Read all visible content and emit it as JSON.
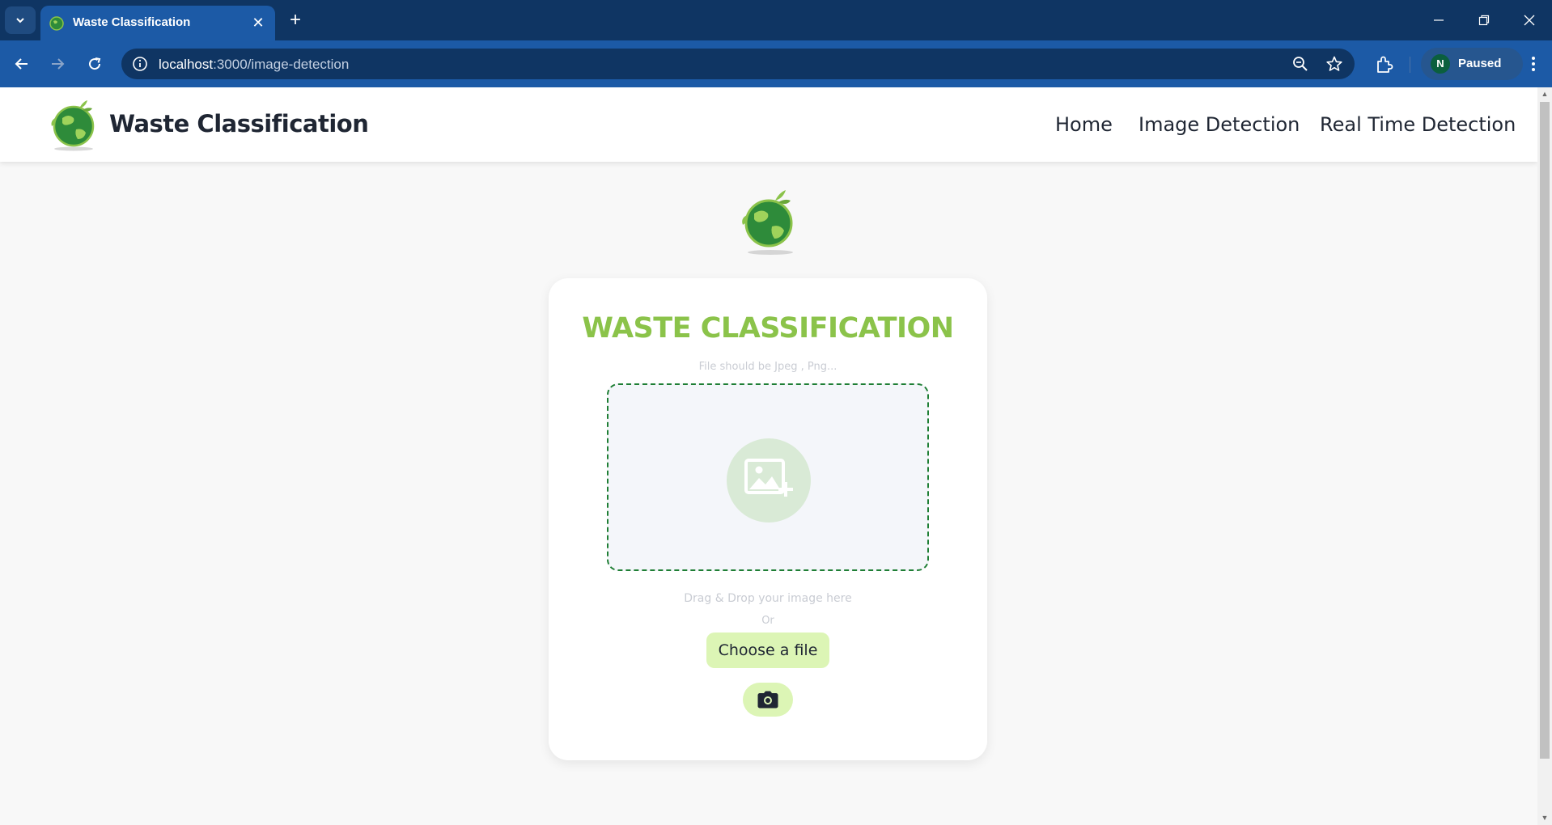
{
  "browser": {
    "tab_title": "Waste Classification",
    "url_host": "localhost",
    "url_rest": ":3000/image-detection",
    "profile_initial": "N",
    "profile_status": "Paused",
    "icons": [
      "tab-list-icon",
      "favicon",
      "close-icon",
      "plus-icon",
      "minimize-icon",
      "restore-icon",
      "window-close-icon",
      "back-icon",
      "forward-icon",
      "reload-icon",
      "info-icon",
      "zoom-icon",
      "star-icon",
      "extensions-icon",
      "menu-icon"
    ]
  },
  "header": {
    "brand": "Waste Classification",
    "nav": [
      "Home",
      "Image Detection",
      "Real Time Detection"
    ]
  },
  "card": {
    "title": "WASTE CLASSIFICATION",
    "file_hint": "File should be Jpeg , Png...",
    "drag_text": "Drag & Drop your image here",
    "or_text": "Or",
    "choose_label": "Choose a file"
  },
  "colors": {
    "accent_green": "#8bc34a",
    "button_green": "#dcf5b5",
    "dropzone_border": "#1e7e34",
    "chrome_dark": "#0f3563",
    "chrome_blue": "#1c5aa6"
  }
}
